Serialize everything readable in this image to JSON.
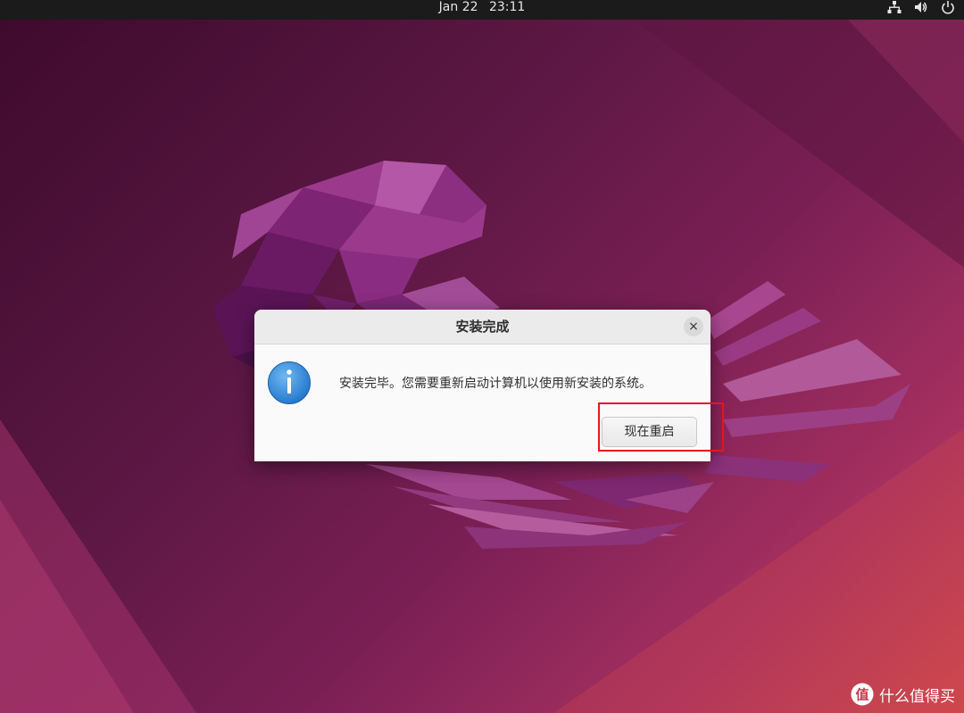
{
  "topbar": {
    "date": "Jan 22",
    "time": "23:11"
  },
  "tray": {
    "icons": [
      "network-icon",
      "volume-icon",
      "power-icon"
    ]
  },
  "dialog": {
    "title": "安装完成",
    "message": "安装完毕。您需要重新启动计算机以使用新安装的系统。",
    "restart_label": "现在重启",
    "close_label": "×",
    "icon": "info-icon"
  },
  "watermark": {
    "text": "什么值得买",
    "icon": "smzdm-logo"
  },
  "colors": {
    "topbar": "#1b1b1b",
    "dialog_bg": "#fafafa",
    "dialog_header": "#ebebeb",
    "info_blue": "#2a8de0",
    "highlight_red": "#e8141c"
  }
}
